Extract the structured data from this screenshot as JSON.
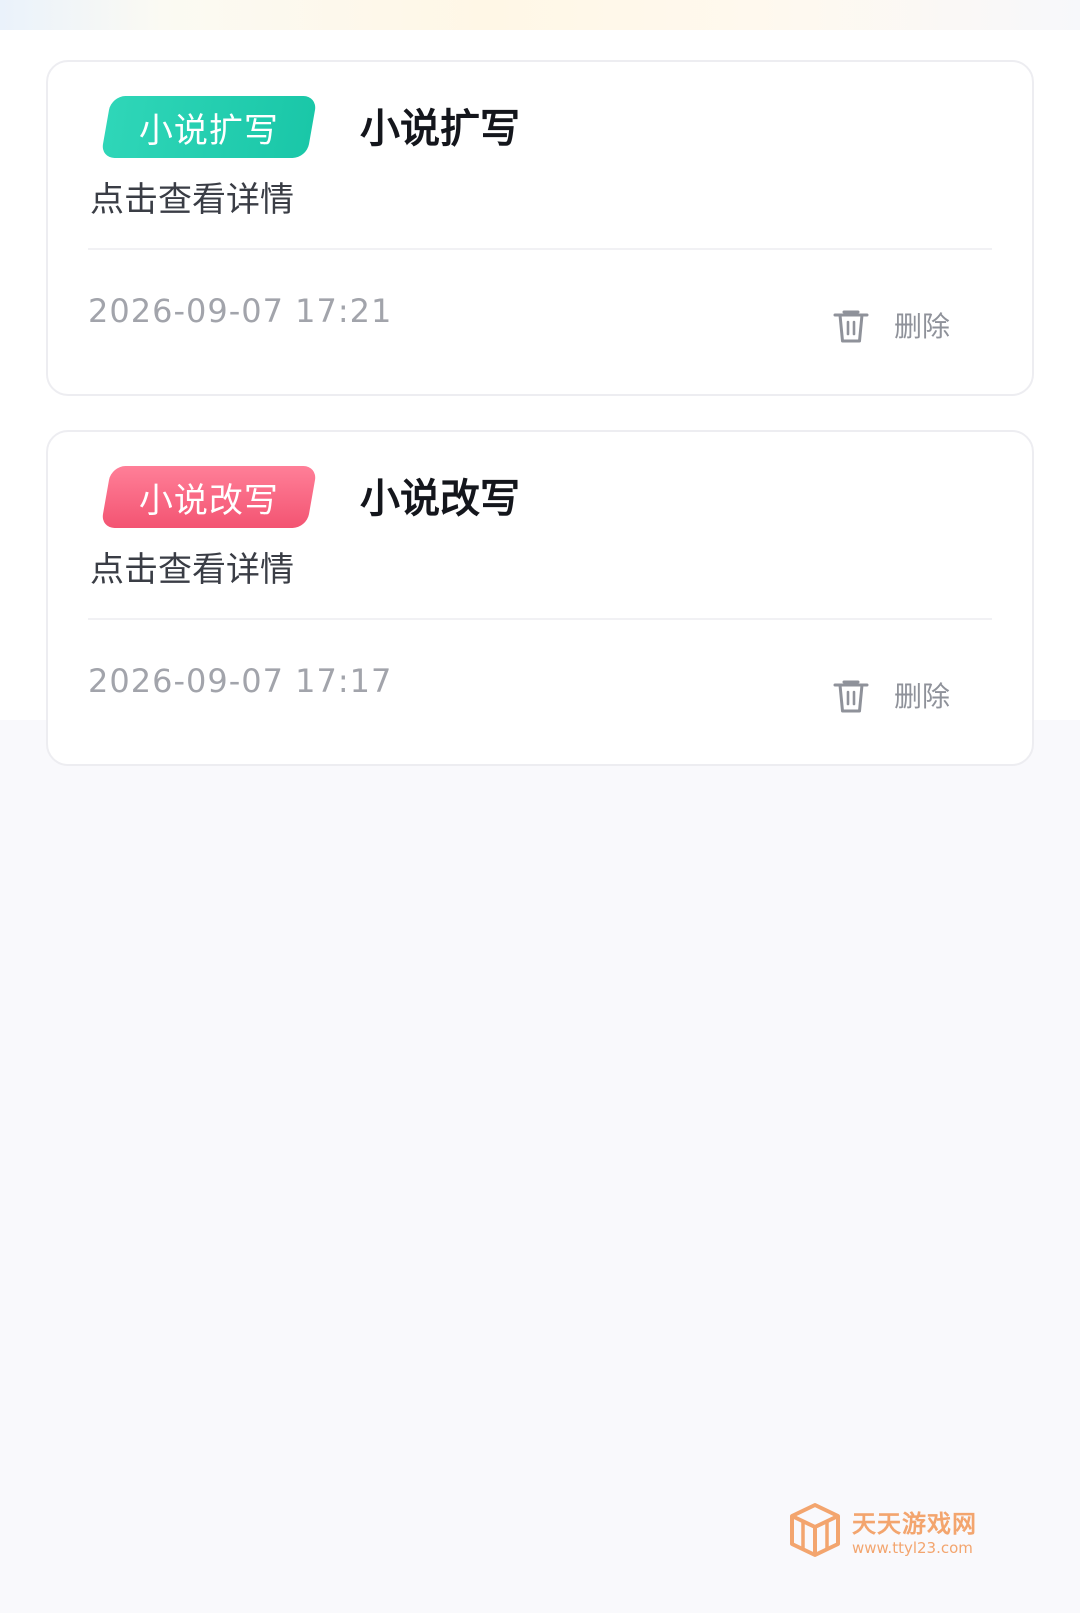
{
  "records": [
    {
      "tag": "小说扩写",
      "tag_color": "#1ac7a8",
      "title": "小说扩写",
      "subtitle": "点击查看详情",
      "timestamp": "2026-09-07 17:21",
      "delete_label": "删除",
      "delete_icon": "trash-icon"
    },
    {
      "tag": "小说改写",
      "tag_color": "#f35472",
      "title": "小说改写",
      "subtitle": "点击查看详情",
      "timestamp": "2026-09-07 17:17",
      "delete_label": "删除",
      "delete_icon": "trash-icon"
    }
  ],
  "watermark": {
    "name": "天天游戏网",
    "url": "www.ttyl23.com",
    "icon": "box-logo-icon",
    "color": "#f3a56e"
  }
}
